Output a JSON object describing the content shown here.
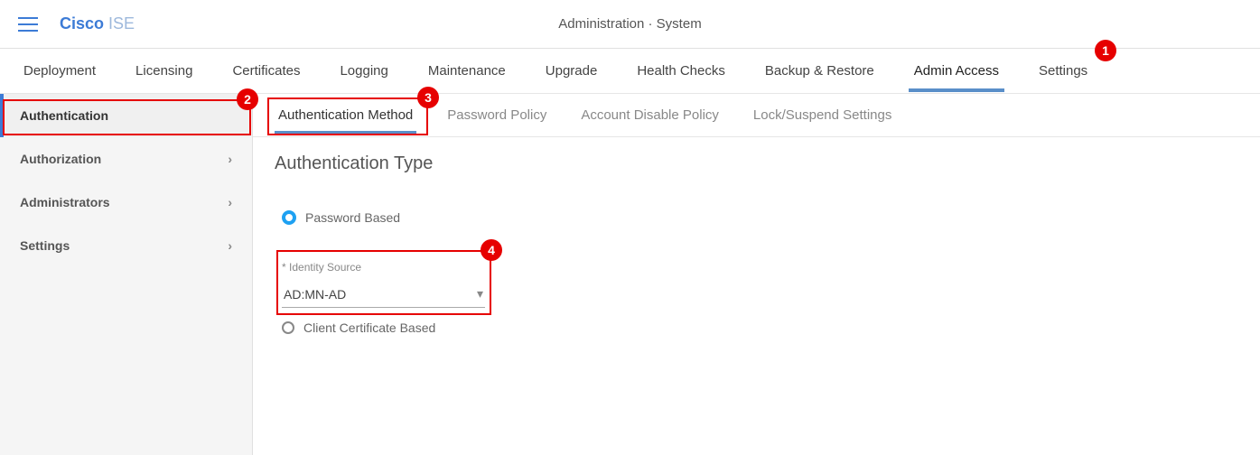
{
  "brand": {
    "cisco": "Cisco",
    "ise": " ISE"
  },
  "breadcrumb": "Administration · System",
  "topnav": [
    "Deployment",
    "Licensing",
    "Certificates",
    "Logging",
    "Maintenance",
    "Upgrade",
    "Health Checks",
    "Backup & Restore",
    "Admin Access",
    "Settings"
  ],
  "topnav_active": 8,
  "sidebar": [
    {
      "label": "Authentication",
      "expandable": false,
      "active": true
    },
    {
      "label": "Authorization",
      "expandable": true,
      "active": false
    },
    {
      "label": "Administrators",
      "expandable": true,
      "active": false
    },
    {
      "label": "Settings",
      "expandable": true,
      "active": false
    }
  ],
  "subtabs": [
    "Authentication Method",
    "Password Policy",
    "Account Disable Policy",
    "Lock/Suspend Settings"
  ],
  "subtabs_active": 0,
  "section_title": "Authentication Type",
  "radio_password": "Password Based",
  "identity_source_label": "Identity Source",
  "identity_source_value": "AD:MN-AD",
  "radio_cert": "Client Certificate Based",
  "markers": {
    "m1": "1",
    "m2": "2",
    "m3": "3",
    "m4": "4"
  }
}
